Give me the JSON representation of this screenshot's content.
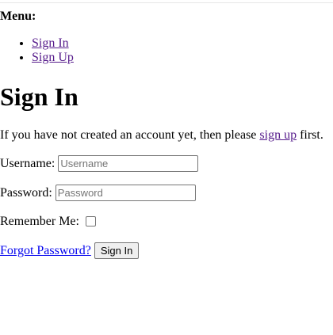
{
  "menu": {
    "label": "Menu:",
    "items": [
      {
        "label": "Sign In"
      },
      {
        "label": "Sign Up"
      }
    ]
  },
  "page": {
    "title": "Sign In",
    "intro_before": "If you have not created an account yet, then please ",
    "intro_link": "sign up",
    "intro_after": " first."
  },
  "form": {
    "username_label": "Username:",
    "username_placeholder": "Username",
    "username_value": "",
    "password_label": "Password:",
    "password_placeholder": "Password",
    "password_value": "",
    "remember_label": "Remember Me:",
    "remember_checked": false,
    "forgot_link": "Forgot Password?",
    "submit_label": "Sign In"
  },
  "colors": {
    "visited_link": "#551a8b",
    "unvisited_link": "#0000ee",
    "text": "#000000",
    "background": "#ffffff"
  }
}
